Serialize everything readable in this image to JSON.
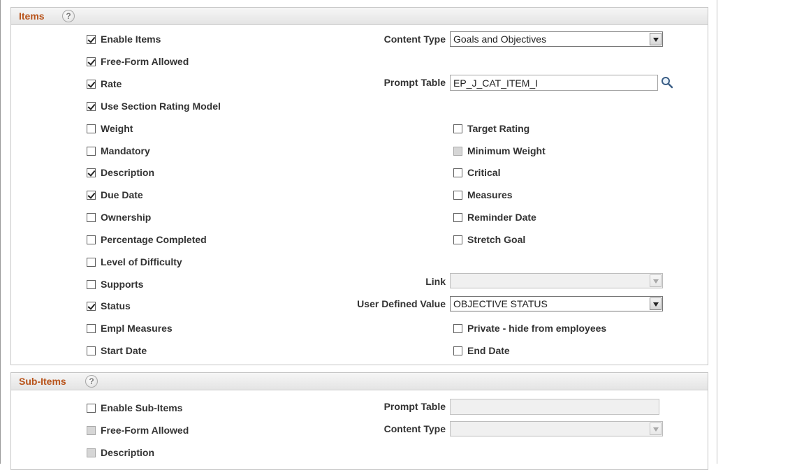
{
  "items_section": {
    "title": "Items",
    "help_icon": "help-icon",
    "checkboxes_left": [
      {
        "label": "Enable Items",
        "checked": true,
        "enabled": true
      },
      {
        "label": "Free-Form Allowed",
        "checked": true,
        "enabled": true
      },
      {
        "label": "Rate",
        "checked": true,
        "enabled": true
      },
      {
        "label": "Use Section Rating Model",
        "checked": true,
        "enabled": true
      },
      {
        "label": "Weight",
        "checked": false,
        "enabled": true
      },
      {
        "label": "Mandatory",
        "checked": false,
        "enabled": true
      },
      {
        "label": "Description",
        "checked": true,
        "enabled": true
      },
      {
        "label": "Due Date",
        "checked": true,
        "enabled": true
      },
      {
        "label": "Ownership",
        "checked": false,
        "enabled": true
      },
      {
        "label": "Percentage Completed",
        "checked": false,
        "enabled": true
      },
      {
        "label": "Level of Difficulty",
        "checked": false,
        "enabled": true
      },
      {
        "label": "Supports",
        "checked": false,
        "enabled": true
      },
      {
        "label": "Status",
        "checked": true,
        "enabled": true
      },
      {
        "label": "Empl Measures",
        "checked": false,
        "enabled": true
      },
      {
        "label": "Start Date",
        "checked": false,
        "enabled": true
      }
    ],
    "checkboxes_right": [
      {
        "label": "Target Rating",
        "checked": false,
        "enabled": true
      },
      {
        "label": "Minimum Weight",
        "checked": false,
        "enabled": false
      },
      {
        "label": "Critical",
        "checked": false,
        "enabled": true
      },
      {
        "label": "Measures",
        "checked": false,
        "enabled": true
      },
      {
        "label": "Reminder Date",
        "checked": false,
        "enabled": true
      },
      {
        "label": "Stretch Goal",
        "checked": false,
        "enabled": true
      },
      {
        "label": "Private - hide from employees",
        "checked": false,
        "enabled": true
      },
      {
        "label": "End Date",
        "checked": false,
        "enabled": true
      }
    ],
    "content_type": {
      "label": "Content Type",
      "value": "Goals and Objectives"
    },
    "prompt_table": {
      "label": "Prompt Table",
      "value": "EP_J_CAT_ITEM_I",
      "icon": "search-icon"
    },
    "link": {
      "label": "Link",
      "value": ""
    },
    "user_defined_value": {
      "label": "User Defined Value",
      "value": "OBJECTIVE STATUS"
    }
  },
  "subitems_section": {
    "title": "Sub-Items",
    "help_icon": "help-icon",
    "checkboxes": [
      {
        "label": "Enable Sub-Items",
        "checked": false,
        "enabled": true
      },
      {
        "label": "Free-Form Allowed",
        "checked": false,
        "enabled": false
      },
      {
        "label": "Description",
        "checked": false,
        "enabled": false
      }
    ],
    "prompt_table": {
      "label": "Prompt Table",
      "value": ""
    },
    "content_type": {
      "label": "Content Type",
      "value": ""
    }
  }
}
